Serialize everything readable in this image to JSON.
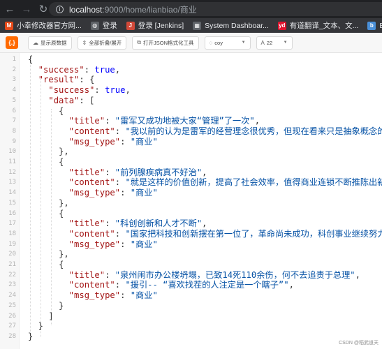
{
  "browser": {
    "url_host": "localhost",
    "url_rest": ":9000/home/lianbiao/商业"
  },
  "bookmarks": [
    {
      "label": "小幸修改器官方网...",
      "icon": "m-logo-icon",
      "color": "#e64a19",
      "glyph": "M"
    },
    {
      "label": "登录",
      "icon": "globe-icon",
      "color": "#5f6368",
      "glyph": "◍"
    },
    {
      "label": "登录 [Jenkins]",
      "icon": "jenkins-icon",
      "color": "#d24939",
      "glyph": "J"
    },
    {
      "label": "System Dashboar...",
      "icon": "grid-icon",
      "color": "#5f6368",
      "glyph": "▦"
    },
    {
      "label": "有道翻译_文本、文...",
      "icon": "youdao-icon",
      "color": "#e0122d",
      "glyph": "yd"
    },
    {
      "label": "Bing Microsoft Tr",
      "icon": "bing-icon",
      "color": "#4a90d9",
      "glyph": "b"
    }
  ],
  "toolbar": {
    "brand_glyph": "{.}",
    "raw_label": "显示原数据",
    "fold_label": "全部折叠/展开",
    "format_label": "打开JSON格式化工具",
    "theme_value": "coy",
    "font_size_value": "22"
  },
  "code_lines": [
    [
      [
        "{",
        "pun"
      ]
    ],
    [
      [
        "  ",
        "pun"
      ],
      [
        "\"success\"",
        "key"
      ],
      [
        ": ",
        "pun"
      ],
      [
        "true",
        "lit"
      ],
      [
        ",",
        "pun"
      ]
    ],
    [
      [
        "  ",
        "pun"
      ],
      [
        "\"result\"",
        "key"
      ],
      [
        ": {",
        "pun"
      ]
    ],
    [
      [
        "    ",
        "pun"
      ],
      [
        "\"success\"",
        "key"
      ],
      [
        ": ",
        "pun"
      ],
      [
        "true",
        "lit"
      ],
      [
        ",",
        "pun"
      ]
    ],
    [
      [
        "    ",
        "pun"
      ],
      [
        "\"data\"",
        "key"
      ],
      [
        ": [",
        "pun"
      ]
    ],
    [
      [
        "      {",
        "pun"
      ]
    ],
    [
      [
        "        ",
        "pun"
      ],
      [
        "\"title\"",
        "key"
      ],
      [
        ": ",
        "pun"
      ],
      [
        "\"雷军又成功地被大家“管理”了一次\"",
        "str"
      ],
      [
        ",",
        "pun"
      ]
    ],
    [
      [
        "        ",
        "pun"
      ],
      [
        "\"content\"",
        "key"
      ],
      [
        ": ",
        "pun"
      ],
      [
        "\"我以前的认为是雷军的经营理念很优秀，但现在看来只是抽象概念的",
        "str"
      ]
    ],
    [
      [
        "        ",
        "pun"
      ],
      [
        "\"msg_type\"",
        "key"
      ],
      [
        ": ",
        "pun"
      ],
      [
        "\"商业\"",
        "str"
      ]
    ],
    [
      [
        "      },",
        "pun"
      ]
    ],
    [
      [
        "      {",
        "pun"
      ]
    ],
    [
      [
        "        ",
        "pun"
      ],
      [
        "\"title\"",
        "key"
      ],
      [
        ": ",
        "pun"
      ],
      [
        "\"前列腺疾病真不好治\"",
        "str"
      ],
      [
        ",",
        "pun"
      ]
    ],
    [
      [
        "        ",
        "pun"
      ],
      [
        "\"content\"",
        "key"
      ],
      [
        ": ",
        "pun"
      ],
      [
        "\"就是这样的价值创新，提高了社会效率，值得商业连锁不断推陈出新",
        "str"
      ]
    ],
    [
      [
        "        ",
        "pun"
      ],
      [
        "\"msg_type\"",
        "key"
      ],
      [
        ": ",
        "pun"
      ],
      [
        "\"商业\"",
        "str"
      ]
    ],
    [
      [
        "      },",
        "pun"
      ]
    ],
    [
      [
        "      {",
        "pun"
      ]
    ],
    [
      [
        "        ",
        "pun"
      ],
      [
        "\"title\"",
        "key"
      ],
      [
        ": ",
        "pun"
      ],
      [
        "\"科创创新和人才不断\"",
        "str"
      ],
      [
        ",",
        "pun"
      ]
    ],
    [
      [
        "        ",
        "pun"
      ],
      [
        "\"content\"",
        "key"
      ],
      [
        ": ",
        "pun"
      ],
      [
        "\"国家把科技和创新摆在第一位了，革命尚未成功，科创事业继续努力",
        "str"
      ]
    ],
    [
      [
        "        ",
        "pun"
      ],
      [
        "\"msg_type\"",
        "key"
      ],
      [
        ": ",
        "pun"
      ],
      [
        "\"商业\"",
        "str"
      ]
    ],
    [
      [
        "      },",
        "pun"
      ]
    ],
    [
      [
        "      {",
        "pun"
      ]
    ],
    [
      [
        "        ",
        "pun"
      ],
      [
        "\"title\"",
        "key"
      ],
      [
        ": ",
        "pun"
      ],
      [
        "\"泉州闹市办公楼坍塌，已致14死110余伤，何不去追责于总理\"",
        "str"
      ],
      [
        ",",
        "pun"
      ]
    ],
    [
      [
        "        ",
        "pun"
      ],
      [
        "\"content\"",
        "key"
      ],
      [
        ": ",
        "pun"
      ],
      [
        "\"援引-- “喜欢找茬的人注定是一个瞎子”\"",
        "str"
      ],
      [
        ",",
        "pun"
      ]
    ],
    [
      [
        "        ",
        "pun"
      ],
      [
        "\"msg_type\"",
        "key"
      ],
      [
        ": ",
        "pun"
      ],
      [
        "\"商业\"",
        "str"
      ]
    ],
    [
      [
        "      }",
        "pun"
      ]
    ],
    [
      [
        "    ]",
        "pun"
      ]
    ],
    [
      [
        "  }",
        "pun"
      ]
    ],
    [
      [
        "}",
        "pun"
      ]
    ]
  ],
  "line_numbers": [
    "1",
    "2",
    "3",
    "4",
    "5",
    "6",
    "7",
    "8",
    "9",
    "10",
    "11",
    "12",
    "13",
    "14",
    "15",
    "16",
    "17",
    "18",
    "19",
    "20",
    "21",
    "22",
    "23",
    "24",
    "25",
    "26",
    "27",
    "28"
  ],
  "watermark": "CSDN @稻武道天"
}
